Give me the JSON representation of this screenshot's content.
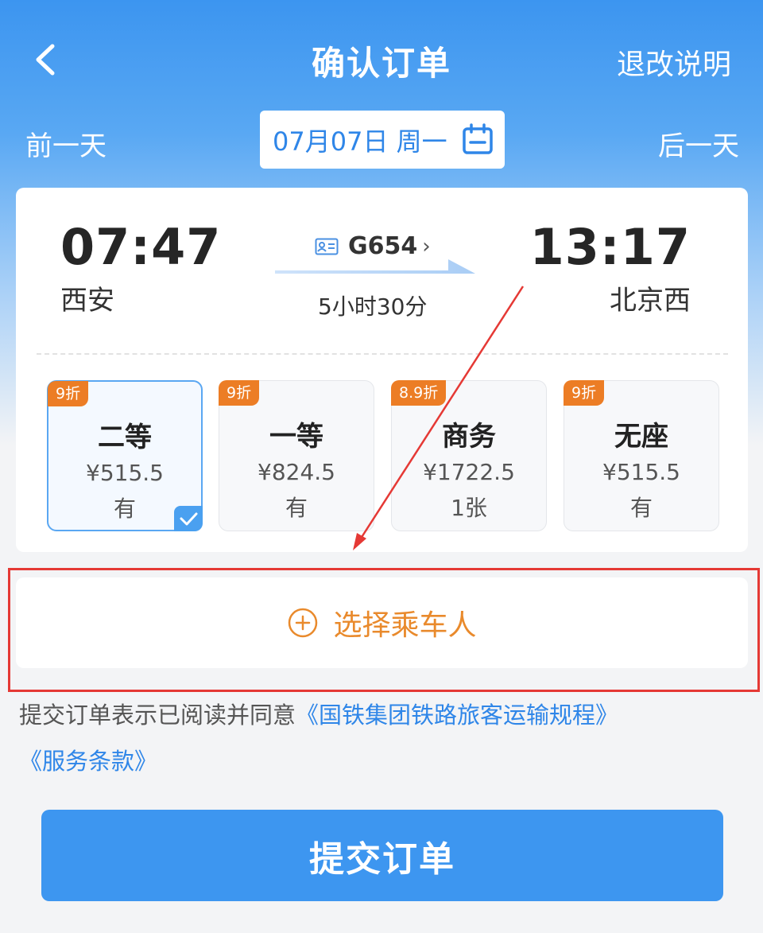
{
  "header": {
    "title": "确认订单",
    "refund_link": "退改说明"
  },
  "date_bar": {
    "prev_day": "前一天",
    "date": "07月07日 周一",
    "next_day": "后一天"
  },
  "trip": {
    "departure_time": "07:47",
    "departure_station": "西安",
    "arrival_time": "13:17",
    "arrival_station": "北京西",
    "train_number": "G654",
    "train_chevron": "›",
    "duration": "5小时30分"
  },
  "seats": [
    {
      "badge": "9折",
      "class": "二等",
      "price": "¥515.5",
      "availability": "有",
      "selected": true
    },
    {
      "badge": "9折",
      "class": "一等",
      "price": "¥824.5",
      "availability": "有",
      "selected": false
    },
    {
      "badge": "8.9折",
      "class": "商务",
      "price": "¥1722.5",
      "availability": "1张",
      "selected": false
    },
    {
      "badge": "9折",
      "class": "无座",
      "price": "¥515.5",
      "availability": "有",
      "selected": false
    }
  ],
  "passenger": {
    "label": "选择乘车人"
  },
  "agreement": {
    "prefix": "提交订单表示已阅读并同意",
    "link1": "《国铁集团铁路旅客运输规程》",
    "link2": "《服务条款》"
  },
  "submit": {
    "label": "提交订单"
  },
  "colors": {
    "primary_blue": "#3d96f0",
    "link_blue": "#2f86e8",
    "discount_orange": "#ec7d25",
    "passenger_orange": "#e98a2c",
    "annotation_red": "#e53935"
  },
  "icons": {
    "back": "chevron-left-icon",
    "calendar": "calendar-icon",
    "train_id": "id-card-icon",
    "check": "checkmark-icon",
    "add": "plus-circle-icon"
  }
}
